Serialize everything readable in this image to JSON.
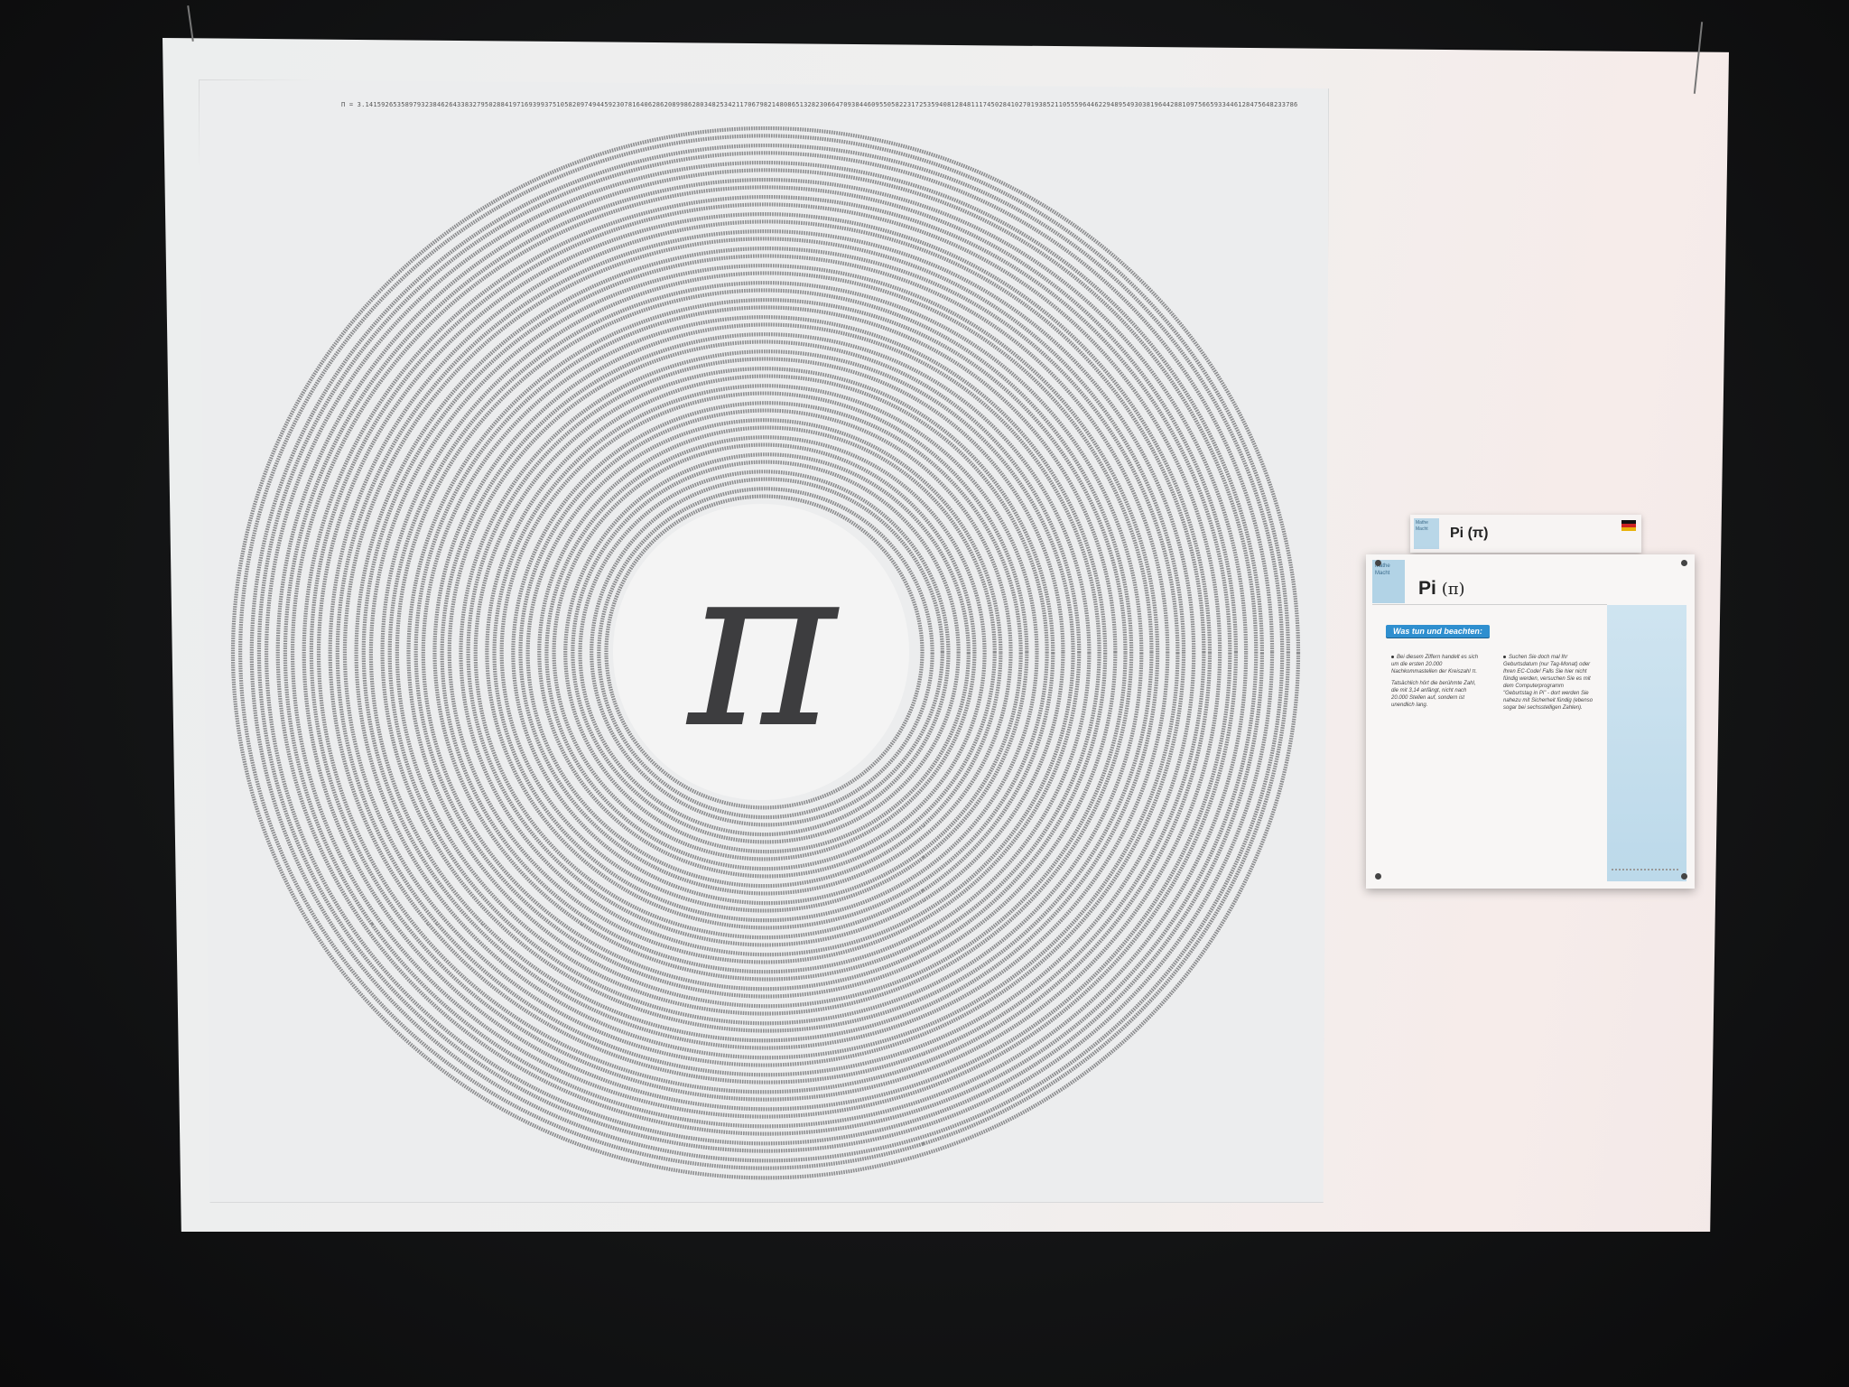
{
  "poster": {
    "digits_line": "Π = 3.14159265358979323846264338327950288419716939937510582097494459230781640628620899862803482534211706798214808651328230664709384460955058223172535940812848111745028410270193852110555964462294895493038196442881097566593344612847564823378678316527120190914564856692346034861045432664821339360726024914127372458700660631558817488152092096282925409171536436789259036001133053054882046652138414695194151160943305727036575959195309218611738193261179310511854807446237996274956735188575272489122793818301194912",
    "symbol": "π"
  },
  "card_back": {
    "tag": "Mathe Macht",
    "title": "Pi (π)"
  },
  "card": {
    "tag": "Mathe Macht",
    "title": "Pi",
    "title_symbol": "(π)",
    "heading": "Was tun und beachten:",
    "col1_p1": "Bei diesem Ziffern handelt es sich um die ersten 20.000 Nachkommastellen der Kreiszahl π.",
    "col1_p2": "Tatsächlich hört die berühmte Zahl, die mit 3,14 anfängt, nicht nach 20.000 Stellen auf, sondern ist unendlich lang.",
    "col2_p1": "Suchen Sie doch mal Ihr Geburtsdatum (nur Tag-Monat) oder Ihren EC-Code! Falls Sie hier nicht fündig werden, versuchen Sie es mit dem Computerprogramm \"Geburtstag in Pi\" - dort werden Sie nahezu mit Sicherheit fündig (ebenso sogar bei sechsstelligen Zahlen)."
  },
  "colors": {
    "accent": "#2f8fcf",
    "strip": "#bcd9ea"
  }
}
